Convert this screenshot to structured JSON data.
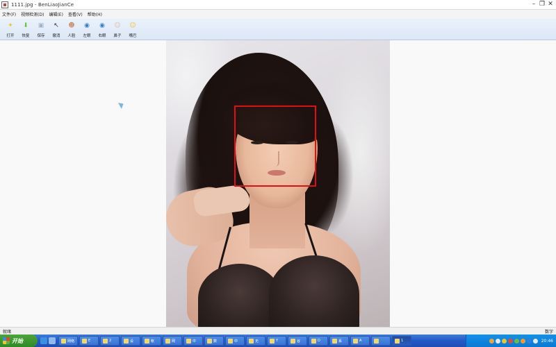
{
  "window": {
    "title": "1111.jpg - BenLiaoJianCe",
    "controls": [
      "–",
      "❐",
      "✕"
    ]
  },
  "menu": {
    "items": [
      "文件(F)",
      "视频检测(D)",
      "编辑(E)",
      "查看(V)",
      "帮助(H)"
    ]
  },
  "toolbar": {
    "tools": [
      {
        "label": "打开",
        "icon": "open-folder-icon",
        "glyph": "✦",
        "color": "#f2c12e"
      },
      {
        "label": "恢复",
        "icon": "restore-arrow-icon",
        "glyph": "⬇",
        "color": "#6cbd3a"
      },
      {
        "label": "保存",
        "icon": "save-disk-icon",
        "glyph": "▣",
        "color": "#9fb2c8"
      },
      {
        "label": "撤消",
        "icon": "undo-cursor-icon",
        "glyph": "↖",
        "color": "#2c2c2c"
      },
      {
        "label": "人脸",
        "icon": "face-person-icon",
        "glyph": "☻",
        "color": "#c9936f"
      },
      {
        "label": "左眼",
        "icon": "left-eye-icon",
        "glyph": "◉",
        "color": "#2f7ed8"
      },
      {
        "label": "右眼",
        "icon": "right-eye-icon",
        "glyph": "◉",
        "color": "#2f7ed8"
      },
      {
        "label": "鼻子",
        "icon": "nose-icon",
        "glyph": "☺",
        "color": "#e0b79c"
      },
      {
        "label": "嘴巴",
        "icon": "mouth-icon",
        "glyph": "☺",
        "color": "#f2c12e"
      }
    ]
  },
  "status": {
    "left": "就绪",
    "right": "数字"
  },
  "taskbar": {
    "start_label": "开始",
    "tasks": [
      {
        "label": "网络"
      },
      {
        "label": "E"
      },
      {
        "label": "2"
      },
      {
        "label": "设"
      },
      {
        "label": "帐"
      },
      {
        "label": "网"
      },
      {
        "label": "中"
      },
      {
        "label": "数"
      },
      {
        "label": "中"
      },
      {
        "label": "无"
      },
      {
        "label": "Y"
      },
      {
        "label": "谷"
      },
      {
        "label": "D"
      },
      {
        "label": "系"
      },
      {
        "label": "A"
      },
      {
        "label": ""
      },
      {
        "label": "1"
      }
    ],
    "clock": "20:46"
  }
}
